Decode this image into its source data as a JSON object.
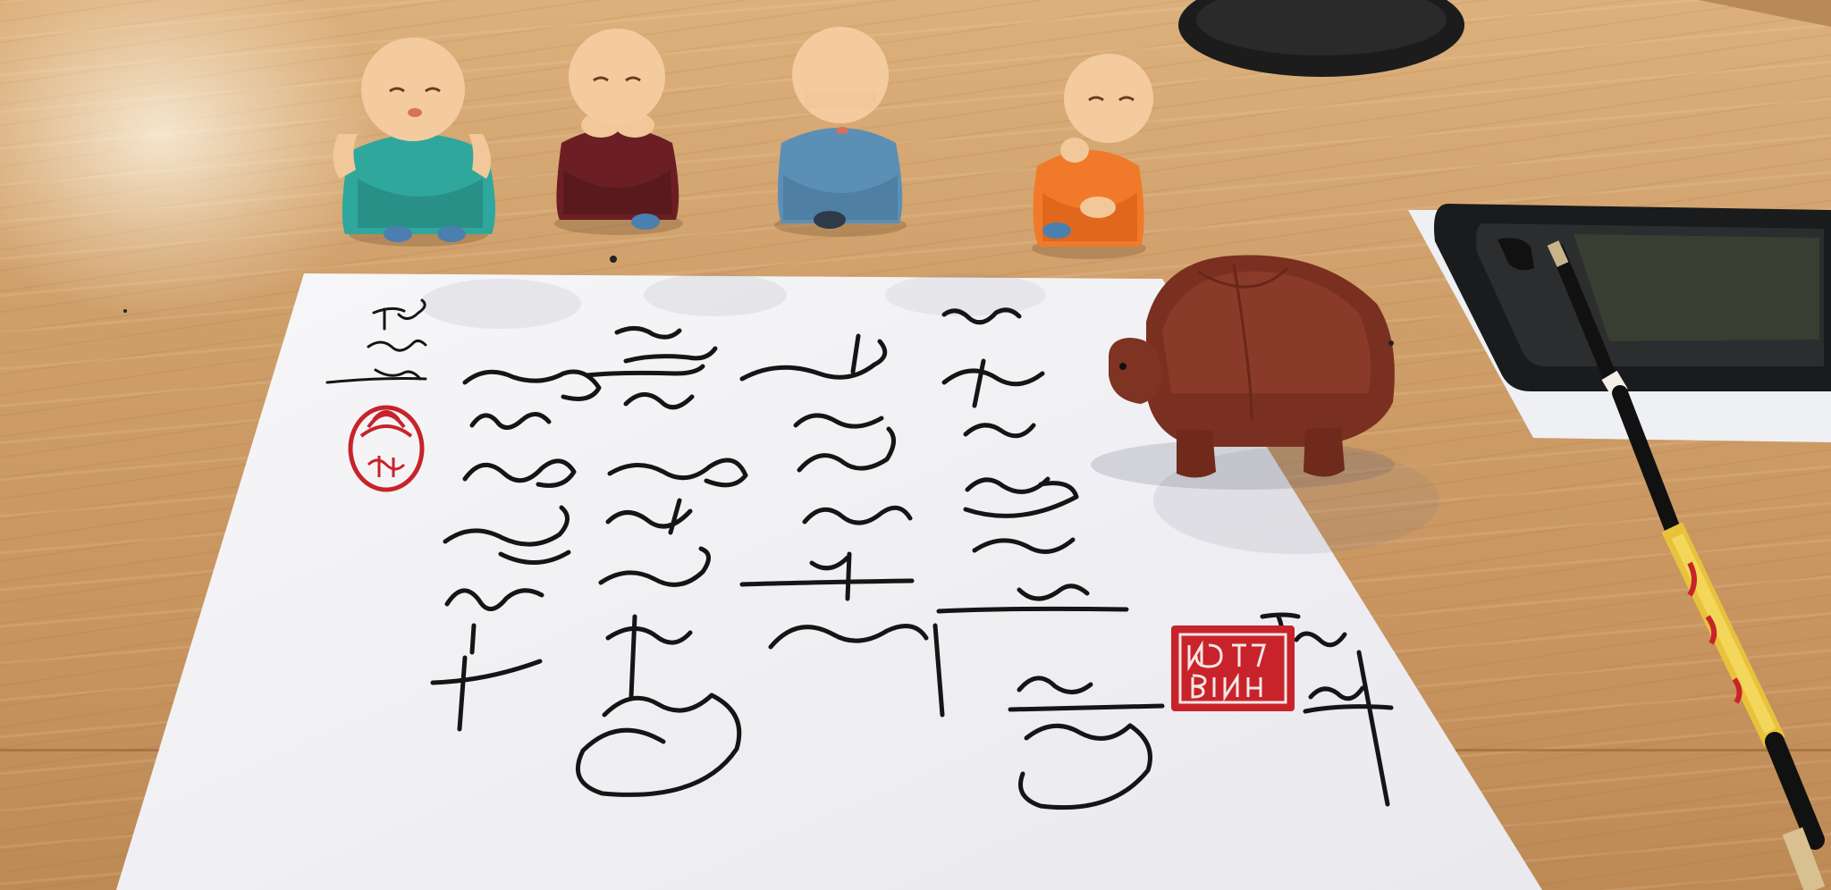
{
  "image": {
    "subject": "calligraphy-desk",
    "colors": {
      "table": "#cf9f6a",
      "paper": "#f3f3f5",
      "ink": "#151515",
      "seal": "#c8232a",
      "monk_teal": "#2fa79c",
      "monk_maroon": "#6b1f24",
      "monk_blue": "#5b8fb5",
      "monk_orange": "#f07a2a",
      "monk_face": "#f2c89a",
      "turtle": "#7a3020",
      "inkstone": "#1e1f20"
    }
  }
}
